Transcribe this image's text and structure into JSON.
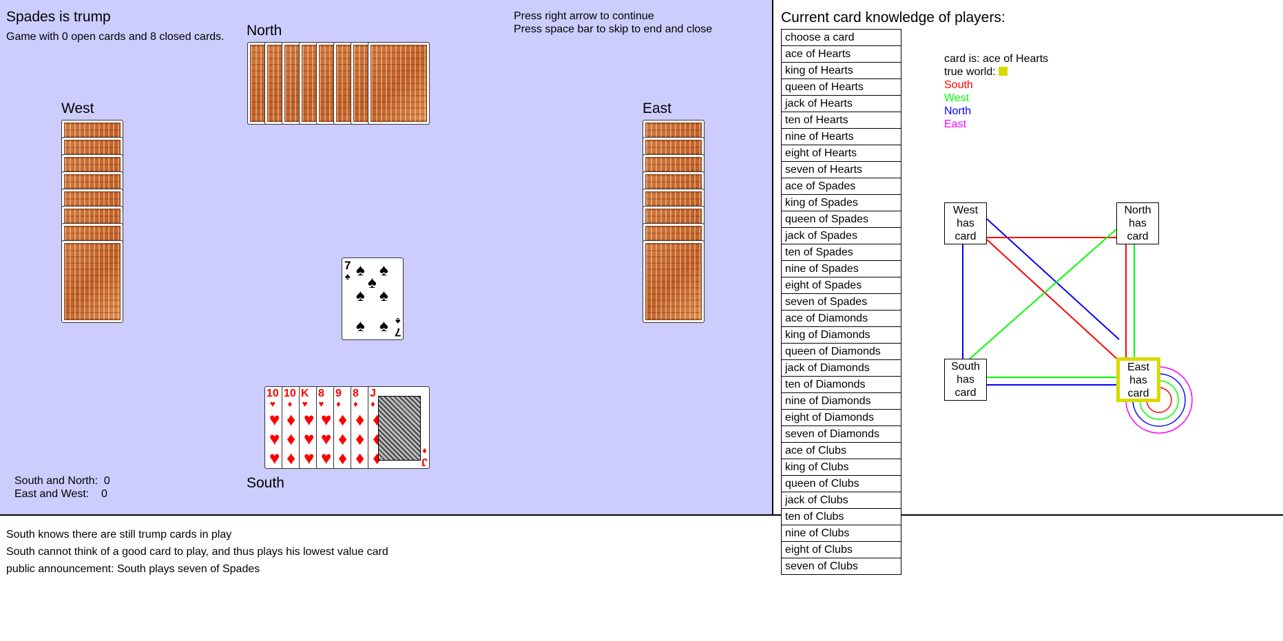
{
  "table": {
    "trump_text": "Spades is trump",
    "game_info": "Game with 0 open cards and 8 closed cards.",
    "instructions": [
      "Press right arrow to continue",
      "Press space bar to skip to end and close"
    ],
    "players": {
      "north": "North",
      "west": "West",
      "east": "East",
      "south": "South"
    },
    "score": {
      "south_north_label": "South and North:",
      "south_north_value": "0",
      "east_west_label": "East and West:",
      "east_west_value": "0"
    },
    "played_card": {
      "rank": "7",
      "suit": "♠",
      "name": "seven of Spades"
    },
    "south_hand": [
      {
        "rank": "10",
        "suit": "♥",
        "color": "#ff0000"
      },
      {
        "rank": "10",
        "suit": "♦",
        "color": "#ff0000"
      },
      {
        "rank": "K",
        "suit": "♥",
        "color": "#ff0000"
      },
      {
        "rank": "8",
        "suit": "♥",
        "color": "#ff0000"
      },
      {
        "rank": "9",
        "suit": "♦",
        "color": "#ff0000"
      },
      {
        "rank": "8",
        "suit": "♦",
        "color": "#ff0000"
      },
      {
        "rank": "J",
        "suit": "♦",
        "color": "#ff0000"
      }
    ]
  },
  "knowledge": {
    "title": "Current card knowledge of players:",
    "cards": [
      "choose a card",
      "ace of Hearts",
      "king of Hearts",
      "queen of Hearts",
      "jack of Hearts",
      "ten of Hearts",
      "nine of Hearts",
      "eight of Hearts",
      "seven of Hearts",
      "ace of Spades",
      "king of Spades",
      "queen of Spades",
      "jack of Spades",
      "ten of Spades",
      "nine of Spades",
      "eight of Spades",
      "seven of Spades",
      "ace of Diamonds",
      "king of Diamonds",
      "queen of Diamonds",
      "jack of Diamonds",
      "ten of Diamonds",
      "nine of Diamonds",
      "eight of Diamonds",
      "seven of Diamonds",
      "ace of Clubs",
      "king of Clubs",
      "queen of Clubs",
      "jack of Clubs",
      "ten of Clubs",
      "nine of Clubs",
      "eight of Clubs",
      "seven of Clubs"
    ],
    "legend": {
      "card_is": "card is: ace of Hearts",
      "true_world": "true world:",
      "true_world_color": "#d9d900",
      "players": [
        {
          "name": "South",
          "color": "#ff0000"
        },
        {
          "name": "West",
          "color": "#00ff00"
        },
        {
          "name": "North",
          "color": "#0000ff"
        },
        {
          "name": "East",
          "color": "#ff00ff"
        }
      ]
    },
    "worlds": {
      "west": [
        "West",
        "has",
        "card"
      ],
      "north": [
        "North",
        "has",
        "card"
      ],
      "south": [
        "South",
        "has",
        "card"
      ],
      "east": [
        "East",
        "has",
        "card"
      ]
    }
  },
  "log": [
    "South knows there are still trump cards in play",
    "South cannot think of a good card to play, and thus plays his lowest value card",
    "public announcement: South plays seven of Spades"
  ]
}
